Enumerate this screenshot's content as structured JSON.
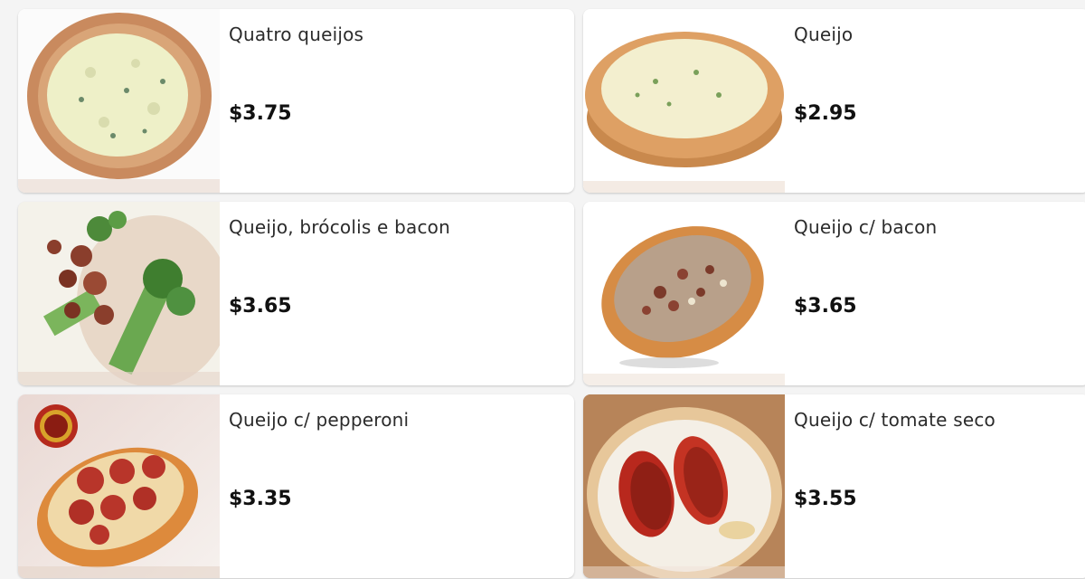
{
  "menu": {
    "items": [
      {
        "name": "Quatro queijos",
        "price": "$3.75",
        "image": "pizza-quatro-queijos"
      },
      {
        "name": "Queijo",
        "price": "$2.95",
        "image": "pizza-queijo"
      },
      {
        "name": "Queijo, brócolis e bacon",
        "price": "$3.65",
        "image": "pizza-brocolis-bacon"
      },
      {
        "name": "Queijo c/ bacon",
        "price": "$3.65",
        "image": "pizza-bacon"
      },
      {
        "name": "Queijo c/ pepperoni",
        "price": "$3.35",
        "image": "pizza-pepperoni"
      },
      {
        "name": "Queijo c/ tomate seco",
        "price": "$3.55",
        "image": "pizza-tomate-seco"
      }
    ]
  }
}
